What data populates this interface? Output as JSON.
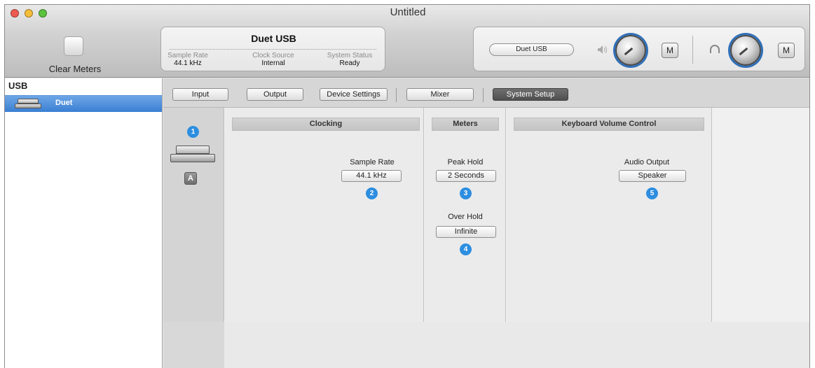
{
  "window": {
    "title": "Untitled"
  },
  "toolbar": {
    "clear_meters_label": "Clear Meters"
  },
  "status": {
    "device_name": "Duet USB",
    "sample_rate_label": "Sample Rate",
    "sample_rate_value": "44.1 kHz",
    "clock_source_label": "Clock Source",
    "clock_source_value": "Internal",
    "system_status_label": "System Status",
    "system_status_value": "Ready"
  },
  "output": {
    "device_select": "Duet USB",
    "speaker_mute_label": "M",
    "headphone_mute_label": "M",
    "speaker_icon": "speaker-icon",
    "headphone_icon": "headphones-icon"
  },
  "sidebar": {
    "group_label": "USB",
    "items": [
      {
        "label": "Duet",
        "selected": true
      }
    ]
  },
  "tabs": [
    {
      "label": "Input",
      "selected": false
    },
    {
      "label": "Output",
      "selected": false
    },
    {
      "label": "Device Settings",
      "selected": false
    },
    {
      "label": "Mixer",
      "selected": false
    },
    {
      "label": "System Setup",
      "selected": true
    }
  ],
  "panels": {
    "device_badge": "1",
    "device_button_label": "A",
    "clocking": {
      "header": "Clocking",
      "sample_rate_label": "Sample Rate",
      "sample_rate_value": "44.1 kHz",
      "badge": "2"
    },
    "meters": {
      "header": "Meters",
      "peak_hold_label": "Peak Hold",
      "peak_hold_value": "2 Seconds",
      "peak_badge": "3",
      "over_hold_label": "Over Hold",
      "over_hold_value": "Infinite",
      "over_badge": "4"
    },
    "keyboard": {
      "header": "Keyboard Volume Control",
      "audio_output_label": "Audio Output",
      "audio_output_value": "Speaker",
      "badge": "5"
    }
  },
  "colors": {
    "selection_blue": "#3a7fd3",
    "badge_blue": "#2d8ee0",
    "close_red": "#ee5b50",
    "minimize_yellow": "#f5bd3a",
    "zoom_green": "#5cc23f"
  }
}
